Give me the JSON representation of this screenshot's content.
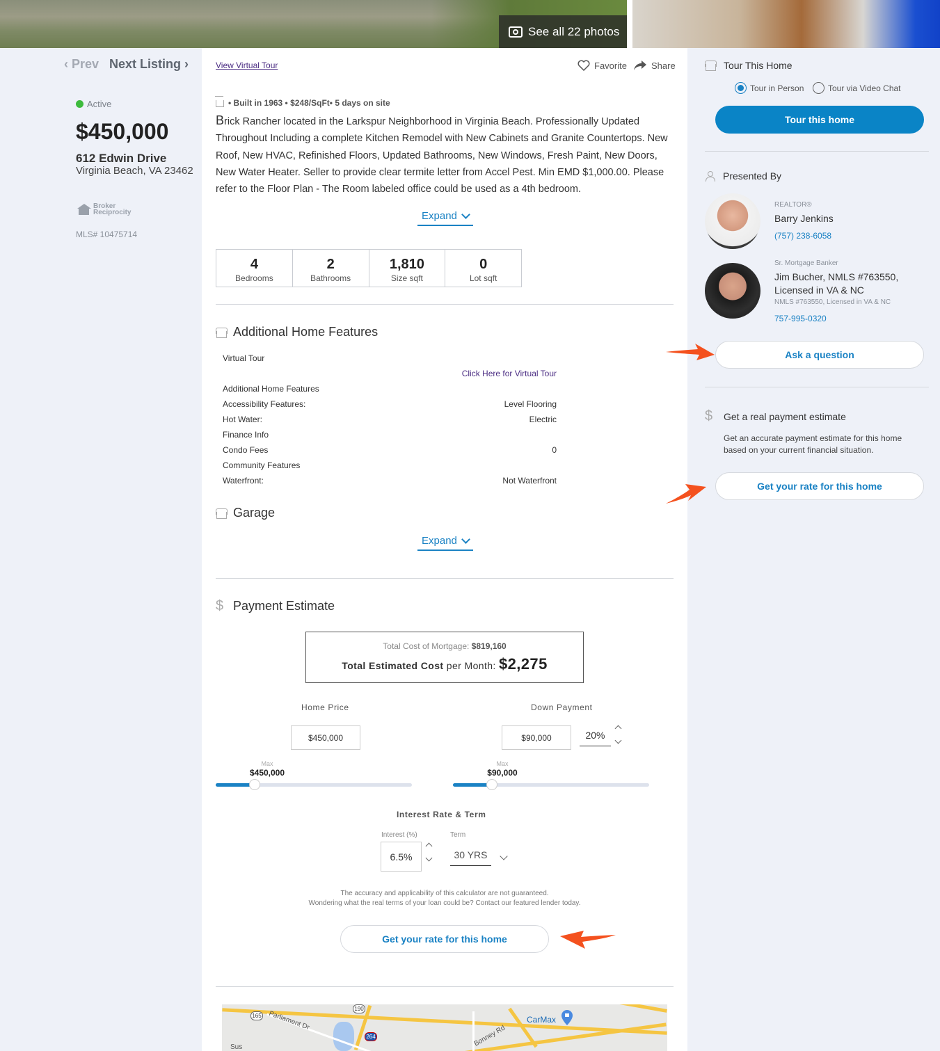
{
  "hero": {
    "photos_label": "See all 22 photos"
  },
  "nav": {
    "prev": "‹ Prev",
    "next": "Next Listing ›"
  },
  "listing": {
    "status": "Active",
    "price": "$450,000",
    "address_line1": "612 Edwin Drive",
    "address_line2": "Virginia Beach, VA 23462",
    "broker_logo_text": [
      "Broker",
      "Reciprocity"
    ],
    "mls": "MLS# 10475714"
  },
  "actions": {
    "virtual_tour": "View Virtual Tour",
    "favorite": "Favorite",
    "share": "Share"
  },
  "summary": {
    "facts": "• Built in 1963 • $248/SqFt• 5 days on site",
    "description_first_letter": "B",
    "description_rest": "rick Rancher located in the Larkspur Neighborhood in Virginia Beach. Professionally Updated Throughout Including a complete Kitchen Remodel with New Cabinets and Granite Countertops. New Roof, New HVAC, Refinished Floors, Updated Bathrooms, New Windows, Fresh Paint, New Doors, New Water Heater. Seller to provide clear termite letter from Accel Pest. Min EMD $1,000.00. Please refer to the Floor Plan - The Room labeled office could be used as a 4th bedroom.",
    "expand": "Expand"
  },
  "stats": [
    {
      "value": "4",
      "label": "Bedrooms"
    },
    {
      "value": "2",
      "label": "Bathrooms"
    },
    {
      "value": "1,810",
      "label": "Size sqft"
    },
    {
      "value": "0",
      "label": "Lot sqft"
    }
  ],
  "features": {
    "title": "Additional Home Features",
    "virtual_tour_label": "Virtual Tour",
    "virtual_tour_link": "Click Here for Virtual Tour",
    "rows": [
      {
        "label": "Additional Home Features",
        "value": ""
      },
      {
        "label": "Accessibility Features:",
        "value": "Level Flooring"
      },
      {
        "label": "Hot Water:",
        "value": "Electric"
      },
      {
        "label": "Finance Info",
        "value": ""
      },
      {
        "label": "Condo Fees",
        "value": "0"
      },
      {
        "label": "Community Features",
        "value": ""
      },
      {
        "label": "Waterfront:",
        "value": "Not Waterfront"
      }
    ],
    "garage_title": "Garage",
    "expand": "Expand"
  },
  "payment": {
    "title": "Payment Estimate",
    "total_cost_label": "Total Cost of Mortgage:",
    "total_cost_value": "$819,160",
    "monthly_label_strong": "Total Estimated Cost",
    "monthly_label_rest": "per Month:",
    "monthly_value": "$2,275",
    "home_price_label": "Home Price",
    "home_price_value": "$450,000",
    "down_payment_label": "Down Payment",
    "down_payment_value": "$90,000",
    "down_payment_pct": "20%",
    "max_label": "Max",
    "home_price_max": "$450,000",
    "down_payment_max": "$90,000",
    "home_price_slider_fraction": 0.2,
    "down_payment_slider_fraction": 0.2,
    "interest_term_label": "Interest Rate & Term",
    "interest_label": "Interest (%)",
    "interest_value": "6.5%",
    "term_label": "Term",
    "term_value": "30 YRS",
    "disclaimer_1": "The accuracy and applicability of this calculator are not guaranteed.",
    "disclaimer_2": "Wondering what the real terms of your loan could be? Contact our featured lender today.",
    "cta": "Get your rate for this home"
  },
  "map": {
    "labels": [
      "Parliament Dr",
      "CarMax",
      "Bonney Rd",
      "Sus"
    ],
    "shields": [
      "165",
      "190",
      "264"
    ]
  },
  "tour": {
    "title": "Tour This Home",
    "option_in_person": "Tour in Person",
    "option_video": "Tour via Video Chat",
    "selected": "Tour in Person",
    "button": "Tour this home"
  },
  "presented": {
    "title": "Presented By",
    "agents": [
      {
        "role": "REALTOR®",
        "name": "Barry Jenkins",
        "sub": "",
        "phone": "(757) 238-6058"
      },
      {
        "role": "Sr. Mortgage Banker",
        "name": "Jim Bucher, NMLS #763550, Licensed in VA & NC",
        "sub": "NMLS #763550, Licensed in VA & NC",
        "phone": "757-995-0320"
      }
    ],
    "ask_button": "Ask a question"
  },
  "estimate": {
    "title": "Get a real payment estimate",
    "text": "Get an accurate payment estimate for this home based on your current financial situation.",
    "button": "Get your rate for this home"
  },
  "colors": {
    "accent": "#1a82c4",
    "tour_button": "#0a84c6",
    "annotation_arrow": "#f4511e",
    "active_dot": "#3dbb3d",
    "visited_link": "#4b2d83"
  }
}
